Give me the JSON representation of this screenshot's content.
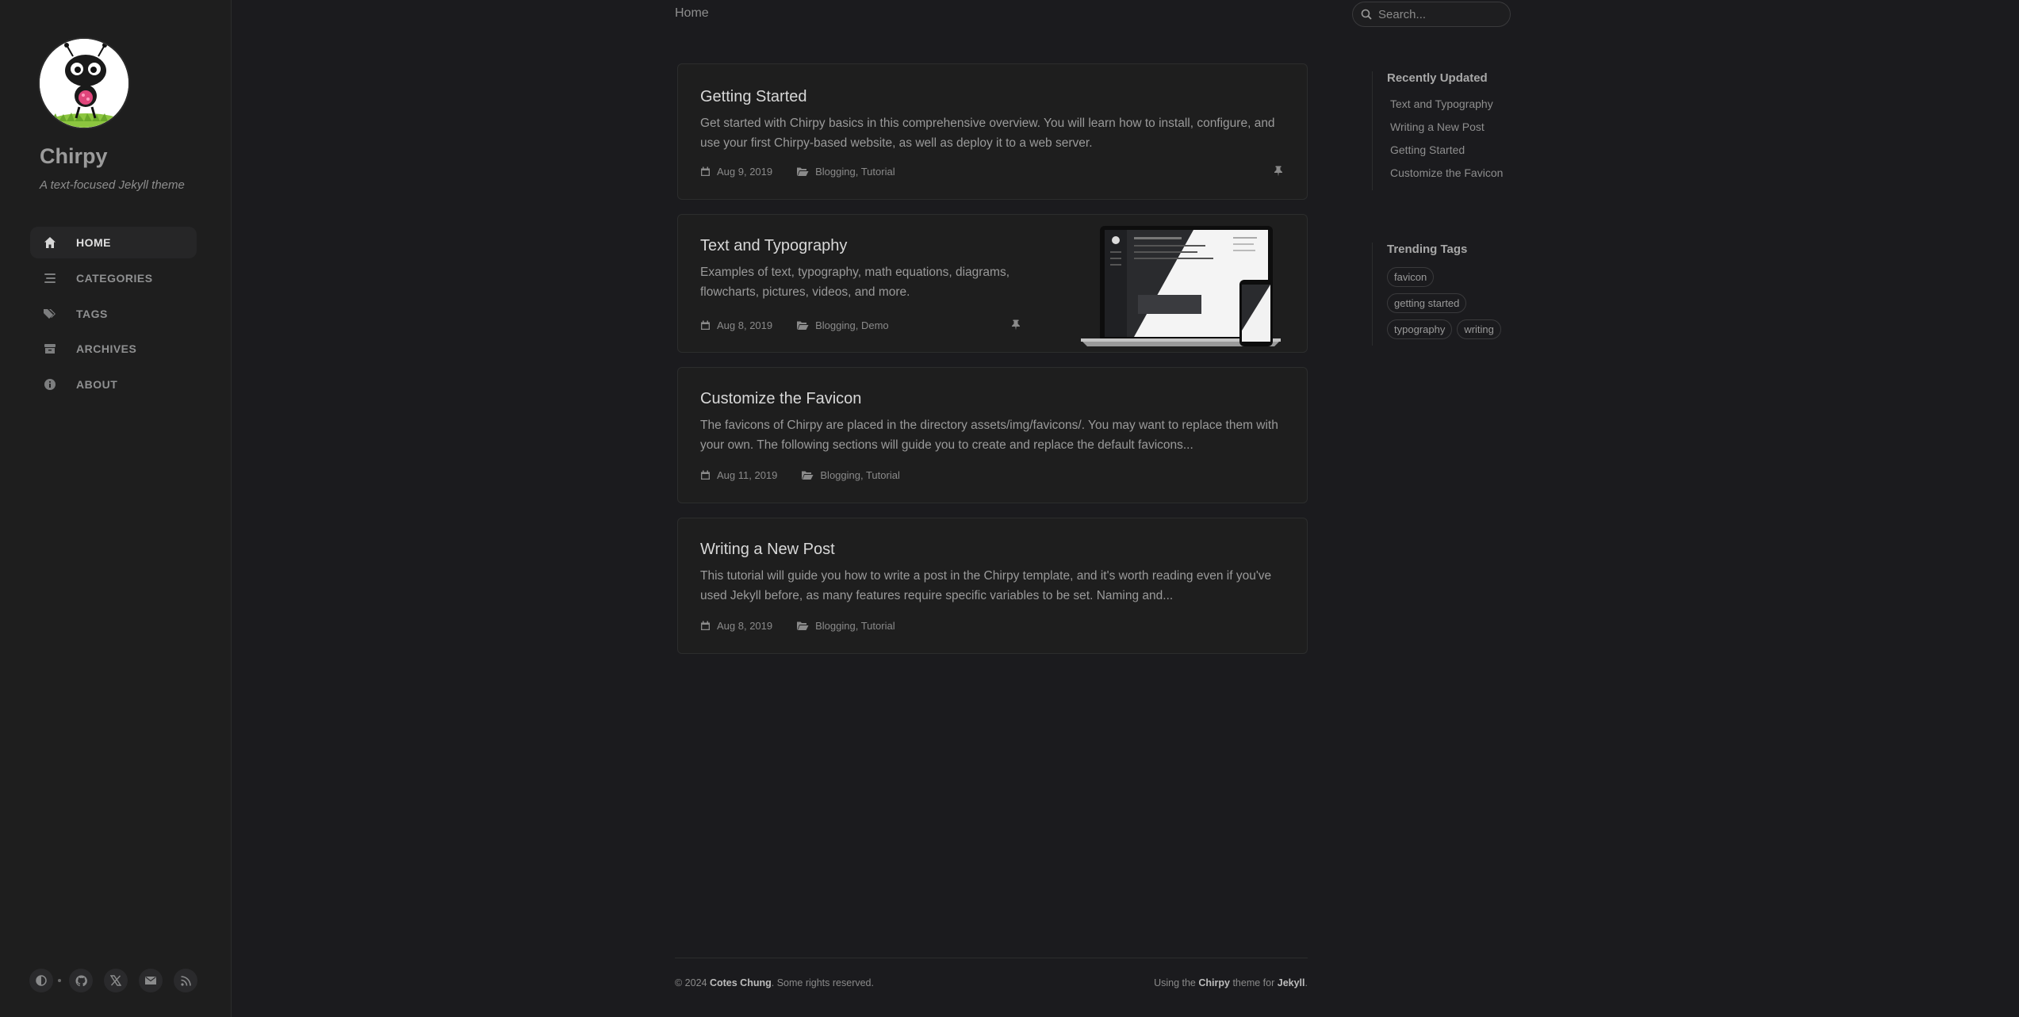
{
  "sidebar": {
    "site_title": "Chirpy",
    "site_subtitle": "A text-focused Jekyll theme",
    "nav": [
      {
        "label": "HOME",
        "icon": "home-icon",
        "active": true
      },
      {
        "label": "CATEGORIES",
        "icon": "stream-icon",
        "active": false
      },
      {
        "label": "TAGS",
        "icon": "tags-icon",
        "active": false
      },
      {
        "label": "ARCHIVES",
        "icon": "archive-icon",
        "active": false
      },
      {
        "label": "ABOUT",
        "icon": "info-circle-icon",
        "active": false
      }
    ],
    "bottom_icons": [
      "theme-toggle-icon",
      "github-icon",
      "x-twitter-icon",
      "email-icon",
      "rss-icon"
    ]
  },
  "topbar": {
    "breadcrumb": "Home",
    "search_placeholder": "Search..."
  },
  "posts": [
    {
      "title": "Getting Started",
      "excerpt": "Get started with Chirpy basics in this comprehensive overview. You will learn how to install, configure, and use your first Chirpy-based website, as well as deploy it to a web server.",
      "date": "Aug 9, 2019",
      "categories": "Blogging, Tutorial",
      "pinned": true
    },
    {
      "title": "Text and Typography",
      "excerpt": "Examples of text, typography, math equations, diagrams, flowcharts, pictures, videos, and more.",
      "date": "Aug 8, 2019",
      "categories": "Blogging, Demo",
      "pinned": true
    },
    {
      "title": "Customize the Favicon",
      "excerpt": "The favicons of Chirpy are placed in the directory assets/img/favicons/. You may want to replace them with your own. The following sections will guide you to create and replace the default favicons...",
      "date": "Aug 11, 2019",
      "categories": "Blogging, Tutorial",
      "pinned": false
    },
    {
      "title": "Writing a New Post",
      "excerpt": "This tutorial will guide you how to write a post in the Chirpy template, and it's worth reading even if you've used Jekyll before, as many features require specific variables to be set. Naming and...",
      "date": "Aug 8, 2019",
      "categories": "Blogging, Tutorial",
      "pinned": false
    }
  ],
  "panel": {
    "recent_heading": "Recently Updated",
    "recent": [
      "Text and Typography",
      "Writing a New Post",
      "Getting Started",
      "Customize the Favicon"
    ],
    "tags_heading": "Trending Tags",
    "tags": [
      "favicon",
      "getting started",
      "typography",
      "writing"
    ]
  },
  "footer": {
    "copyright_prefix": "© 2024",
    "author": "Cotes Chung",
    "rights": ". Some rights reserved.",
    "using": "Using the",
    "theme": "Chirpy",
    "theme_for": "theme for",
    "jekyll": "Jekyll",
    "end": "."
  },
  "colors": {
    "background": "#1b1b1e",
    "sidebar": "#1e1e1e",
    "card_border": "#2c2d2d"
  }
}
